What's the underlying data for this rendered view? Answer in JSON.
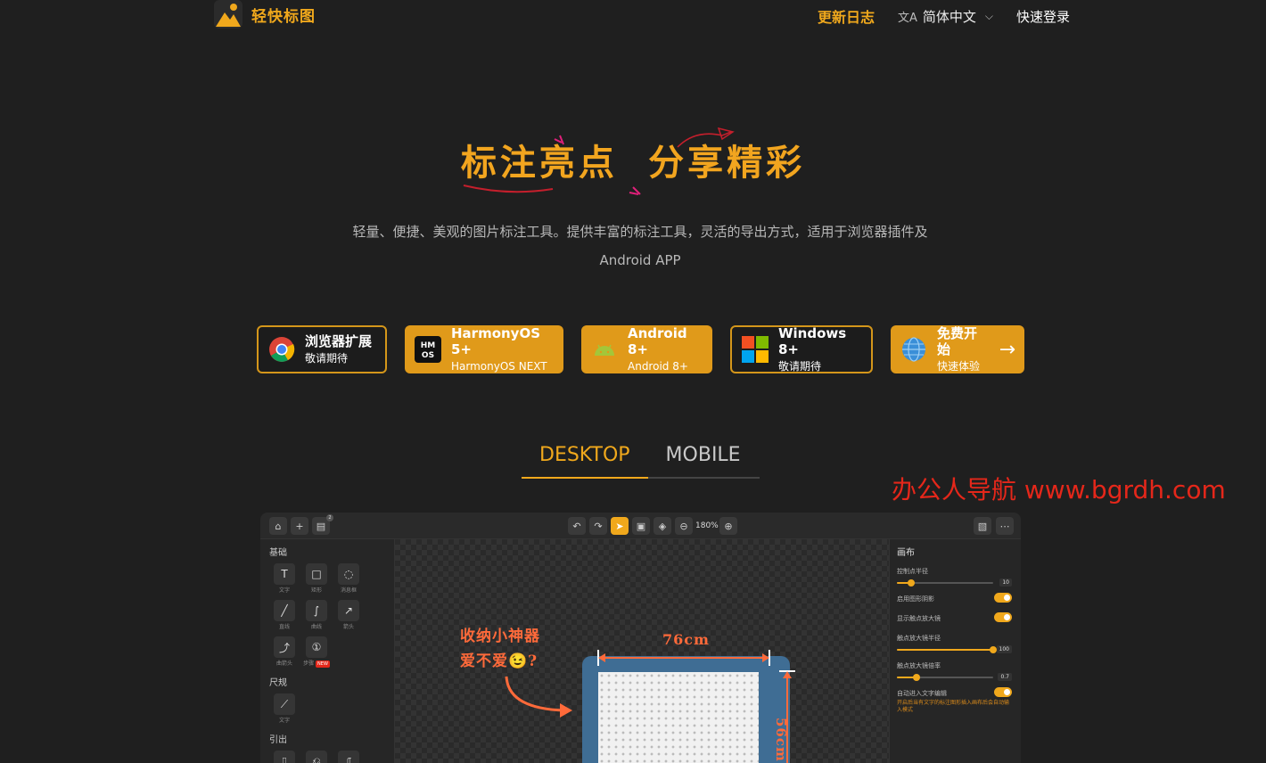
{
  "nav": {
    "brand": "轻快标图",
    "changelog": "更新日志",
    "language": "简体中文",
    "login": "快速登录"
  },
  "hero": {
    "title_part1": "标注亮点",
    "title_part2": "分享精彩",
    "subtitle_line1": "轻量、便捷、美观的图片标注工具。提供丰富的标注工具，灵活的导出方式，适用于浏览器插件及",
    "subtitle_line2": "Android APP"
  },
  "platforms": [
    {
      "main": "浏览器扩展",
      "sub": "敬请期待",
      "icon": "chrome-icon"
    },
    {
      "main": "HarmonyOS 5+",
      "sub": "HarmonyOS NEXT",
      "icon": "harmonyos-icon"
    },
    {
      "main": "Android 8+",
      "sub": "Android 8+",
      "icon": "android-icon"
    },
    {
      "main": "Windows 8+",
      "sub": "敬请期待",
      "icon": "windows-icon"
    },
    {
      "main": "免费开始",
      "sub": "快速体验",
      "icon": "globe-icon"
    }
  ],
  "tabs": {
    "desktop": "DESKTOP",
    "mobile": "MOBILE"
  },
  "watermark": "办公人导航 www.bgrdh.com",
  "colors": {
    "accent": "#f0a81c",
    "background": "#1f1f1f",
    "annotation": "#ff6a3a"
  },
  "app": {
    "history_badge": "2",
    "zoom": "180%",
    "left": {
      "section_basic": "基础",
      "tools_basic": [
        {
          "label": "文字",
          "icon": "text-icon"
        },
        {
          "label": "矩形",
          "icon": "rect-icon"
        },
        {
          "label": "消息框",
          "icon": "bubble-icon"
        },
        {
          "label": "直线",
          "icon": "line-icon"
        },
        {
          "label": "曲线",
          "icon": "curve-icon"
        },
        {
          "label": "箭头",
          "icon": "arrow-icon"
        },
        {
          "label": "曲箭头",
          "icon": "curved-arrow-icon"
        },
        {
          "label": "步骤",
          "icon": "step-icon"
        }
      ],
      "new_badge": "NEW",
      "section_ruler": "尺规",
      "tools_ruler": [
        {
          "label": "文字",
          "icon": "ruler-icon"
        }
      ],
      "section_callout": "引出"
    },
    "canvas": {
      "anno_line1": "收纳小神器",
      "anno_line2": "爱不爱😉?",
      "dim_width": "76cm",
      "dim_height": "56cm"
    },
    "right": {
      "title": "画布",
      "ctrl_radius_label": "控制点半径",
      "ctrl_radius_value": "10",
      "ctrl_radius_fraction": 0.15,
      "shadow_label": "启用图形阴影",
      "magnifier_label": "显示触点放大镜",
      "mag_radius_label": "触点放大镜半径",
      "mag_radius_value": "100",
      "mag_radius_fraction": 1.0,
      "mag_ratio_label": "触点放大镜倍率",
      "mag_ratio_value": "0.7",
      "mag_ratio_fraction": 0.2,
      "auto_edit_label": "自动进入文字编辑",
      "auto_edit_hint": "开启后当有文字的标注图形插入画布后会自动输入模式"
    }
  }
}
